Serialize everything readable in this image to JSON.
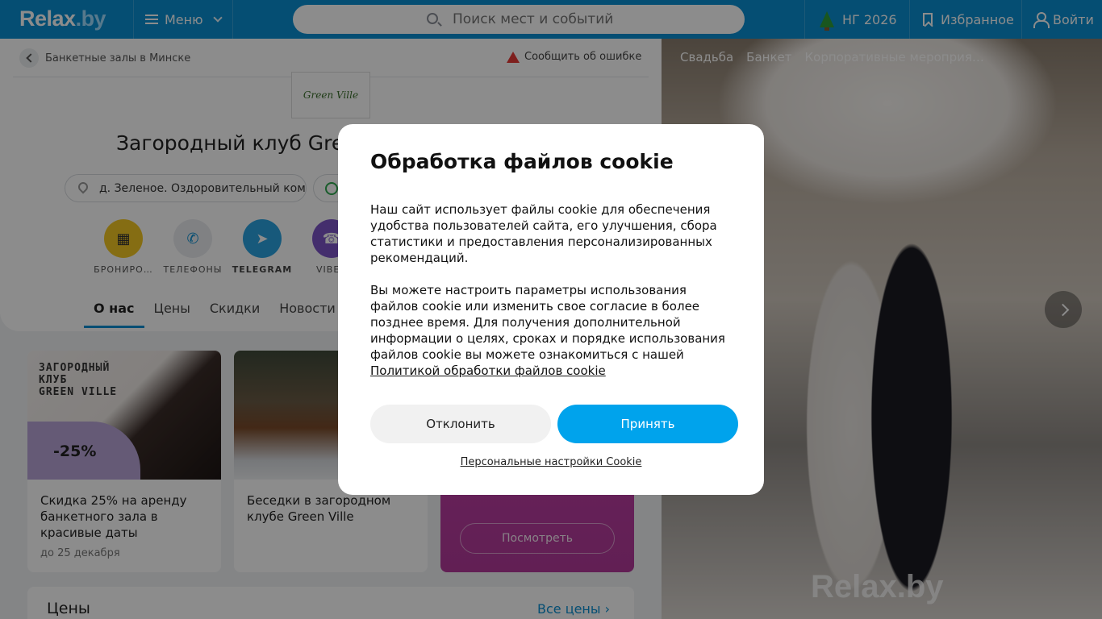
{
  "header": {
    "logo": "Relax",
    "logo_suffix": ".by",
    "menu_label": "Меню",
    "search_placeholder": "Поиск мест и событий",
    "ng_label": "НГ 2026",
    "favorites_label": "Избранное",
    "login_label": "Войти"
  },
  "breadcrumb": {
    "label": "Банкетные залы в Минске"
  },
  "report_label": "Сообщить об ошибке",
  "business": {
    "logo_text": "Green Ville",
    "title": "Загородный клуб Green Ville",
    "address": "д. Зеленое. Оздоровительный комплекс"
  },
  "actions": [
    {
      "label": "БРОНИРО…",
      "color": "#f3c623"
    },
    {
      "label": "ТЕЛЕФОНЫ",
      "color": "#e9ebef"
    },
    {
      "label": "TELEGRAM",
      "color": "#2aa3e0"
    },
    {
      "label": "VIBER",
      "color": "#7d55c7"
    }
  ],
  "tabs": [
    {
      "label": "О нас",
      "active": true
    },
    {
      "label": "Цены"
    },
    {
      "label": "Скидки"
    },
    {
      "label": "Новости"
    }
  ],
  "cards": [
    {
      "promo_text": "ЗАГОРОДНЫЙ\nКЛУБ\nGREEN VILLE",
      "promo_pct": "-25%",
      "title": "Скидка 25% на аренду банкетного зала в красивые даты",
      "subtitle": "до 25 декабря"
    },
    {
      "title": "Беседки в загородном клубе Green Ville"
    },
    {
      "button": "Посмотреть"
    }
  ],
  "prices": {
    "heading": "Цены",
    "all_label": "Все цены"
  },
  "gallery": {
    "tags": [
      "Свадьба",
      "Банкет",
      "Корпоративные мероприя…"
    ],
    "watermark": "Relax.by"
  },
  "cookie_modal": {
    "title": "Обработка файлов cookie",
    "paragraph1": "Наш сайт использует файлы cookie для обеспечения удобства пользователей сайта, его улучшения, сбора статистики и предоставления персонализированных рекомендаций.",
    "paragraph2": "Вы можете настроить параметры использования файлов cookie или изменить свое согласие в более позднее время. Для получения дополнительной информации о целях, сроках и порядке использования файлов cookie вы можете ознакомиться с нашей",
    "policy_link": "Политикой обработки файлов cookie",
    "decline": "Отклонить",
    "accept": "Принять",
    "settings": "Персональные настройки Cookie"
  },
  "colors": {
    "brand_blue": "#0a8fd1",
    "accept_blue": "#00a3ec",
    "promo_magenta": "#c53faa"
  }
}
